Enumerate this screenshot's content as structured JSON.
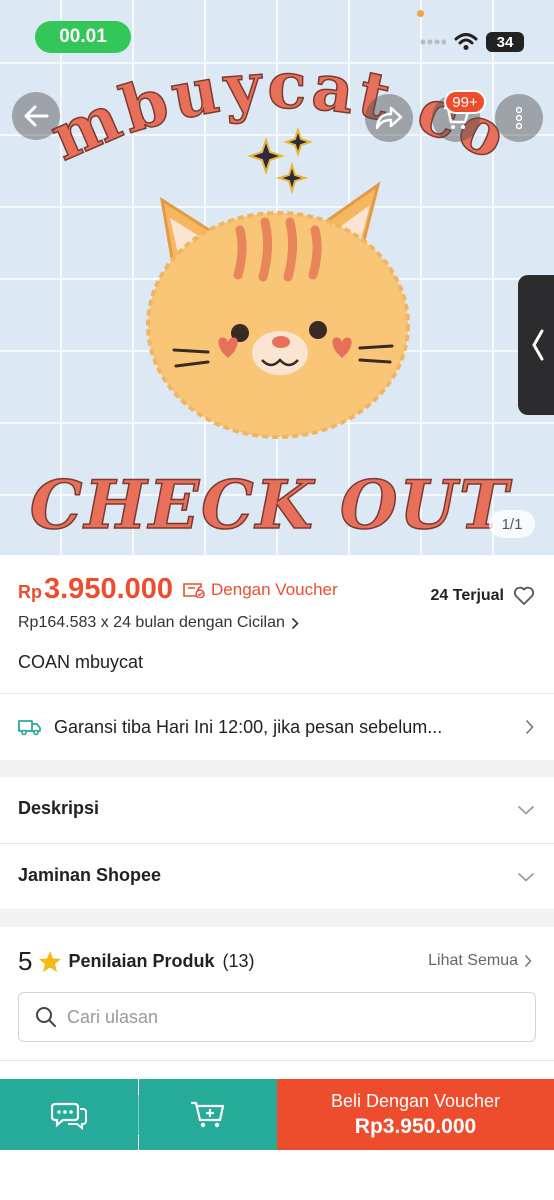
{
  "status_bar": {
    "time": "00.01",
    "battery": "34"
  },
  "hero": {
    "brand_line1": "mbuycat co",
    "brand_line2": "CHECK OUT",
    "cart_badge": "99+",
    "image_counter": "1/1"
  },
  "product": {
    "currency": "Rp",
    "price": "3.950.000",
    "voucher_label": "Dengan Voucher",
    "sold": "24 Terjual",
    "installment": "Rp164.583 x 24 bulan dengan Cicilan",
    "title": "COAN mbuycat"
  },
  "shipping": {
    "text": "Garansi tiba Hari Ini 12:00, jika pesan sebelum..."
  },
  "sections": {
    "description": "Deskripsi",
    "guarantee": "Jaminan Shopee"
  },
  "reviews": {
    "score": "5",
    "label": "Penilaian Produk",
    "count": "(13)",
    "see_all": "Lihat Semua",
    "search_placeholder": "Cari ulasan"
  },
  "bottom_bar": {
    "buy_label": "Beli Dengan Voucher",
    "buy_price": "Rp3.950.000"
  },
  "colors": {
    "accent": "#ee4d2d",
    "green": "#26aa99",
    "status_green": "#33c759"
  }
}
